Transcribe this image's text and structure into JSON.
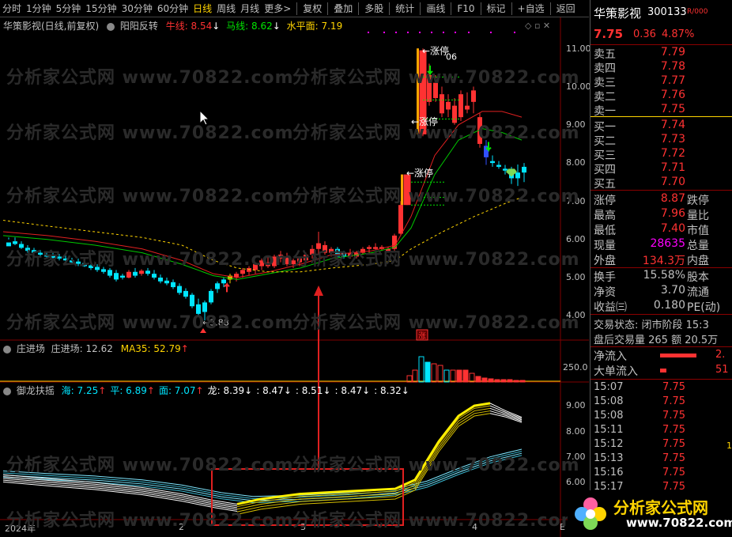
{
  "toolbar": {
    "periods": [
      "分时",
      "1分钟",
      "5分钟",
      "15分钟",
      "30分钟",
      "60分钟",
      "日线",
      "周线",
      "月线",
      "更多>"
    ],
    "active_period": "日线",
    "tools": [
      "复权",
      "叠加",
      "多股",
      "统计",
      "画线",
      "F10",
      "标记",
      "+自选",
      "返回"
    ]
  },
  "main": {
    "stock_title": "华策影视(日线,前复权)",
    "indicator_name": "阳阳反转",
    "niu_label": "牛线: 8.54",
    "ma_label": "马线: 8.62",
    "level_label": "水平面: 7.19",
    "annotations": {
      "zt1": "涨停",
      "zt2": "涨停",
      "zt3": "涨停",
      "price_top": "06",
      "low_price": "3.88",
      "zhang": "涨"
    },
    "price_axis": [
      "11.00",
      "10.00",
      "9.00",
      "8.00",
      "7.00",
      "6.00",
      "5.00",
      "4.00"
    ]
  },
  "vol_panel": {
    "name": "庄进场",
    "label1": "庄进场: 12.62",
    "label2": "MA35: 52.79",
    "axis": "250.0"
  },
  "bottom_panel": {
    "name": "御龙扶摇",
    "labels": [
      {
        "text": "海: 7.25",
        "color": "#00e5ff"
      },
      {
        "text": "平: 6.89",
        "color": "#00e5ff"
      },
      {
        "text": "面: 7.07",
        "color": "#00e5ff"
      },
      {
        "text": "龙: 8.39",
        "color": "#ffffff"
      },
      {
        "text": ": 8.47",
        "color": "#ffffff"
      },
      {
        "text": ": 8.51",
        "color": "#ffffff"
      },
      {
        "text": ": 8.47",
        "color": "#ffffff"
      },
      {
        "text": ": 8.32",
        "color": "#ffffff"
      }
    ],
    "axis": [
      "9.00",
      "8.00",
      "7.00",
      "6.00"
    ]
  },
  "date_axis": [
    "2024年",
    "2",
    "3",
    "4",
    "E"
  ],
  "watermark": "分析家公式网 www.70822.com",
  "right_panel": {
    "name": "华策影视",
    "code": "300133",
    "tag": "R/000",
    "price": "7.75",
    "change": "0.36",
    "pct": "4.87%",
    "asks": [
      {
        "label": "卖五",
        "price": "7.79"
      },
      {
        "label": "卖四",
        "price": "7.78"
      },
      {
        "label": "卖三",
        "price": "7.77"
      },
      {
        "label": "卖二",
        "price": "7.76"
      },
      {
        "label": "卖一",
        "price": "7.75"
      }
    ],
    "bids": [
      {
        "label": "买一",
        "price": "7.74"
      },
      {
        "label": "买二",
        "price": "7.73"
      },
      {
        "label": "买三",
        "price": "7.72"
      },
      {
        "label": "买四",
        "price": "7.71"
      },
      {
        "label": "买五",
        "price": "7.70"
      }
    ],
    "stats": [
      {
        "l": "涨停",
        "v": "8.87",
        "l2": "跌停"
      },
      {
        "l": "最高",
        "v": "7.96",
        "l2": "量比"
      },
      {
        "l": "最低",
        "v": "7.40",
        "l2": "市值"
      },
      {
        "l": "现量",
        "v": "28635",
        "l2": "总量"
      },
      {
        "l": "外盘",
        "v": "134.3万",
        "l2": "内盘"
      }
    ],
    "stats2": [
      {
        "l": "换手",
        "v": "15.58%",
        "l2": "股本"
      },
      {
        "l": "净资",
        "v": "3.70",
        "l2": "流通"
      },
      {
        "l": "收益㈢",
        "v": "0.180",
        "l2": "PE(动)"
      }
    ],
    "trade_state": "交易状态: 闭市阶段  15:3",
    "after_hours": "盘后交易量 265 额 20.5万",
    "net_flow": {
      "label": "净流入",
      "value": "2."
    },
    "big_flow": {
      "label": "大单流入",
      "value": "51"
    },
    "ticks": [
      {
        "t": "15:07",
        "p": "7.75"
      },
      {
        "t": "15:08",
        "p": "7.75"
      },
      {
        "t": "15:08",
        "p": "7.75"
      },
      {
        "t": "15:11",
        "p": "7.75"
      },
      {
        "t": "15:12",
        "p": "7.75"
      },
      {
        "t": "15:13",
        "p": "7.75"
      },
      {
        "t": "15:16",
        "p": "7.75"
      },
      {
        "t": "15:17",
        "p": "7.75"
      }
    ],
    "logo": "分析家公式网",
    "logo_url": "www.70822.com"
  }
}
